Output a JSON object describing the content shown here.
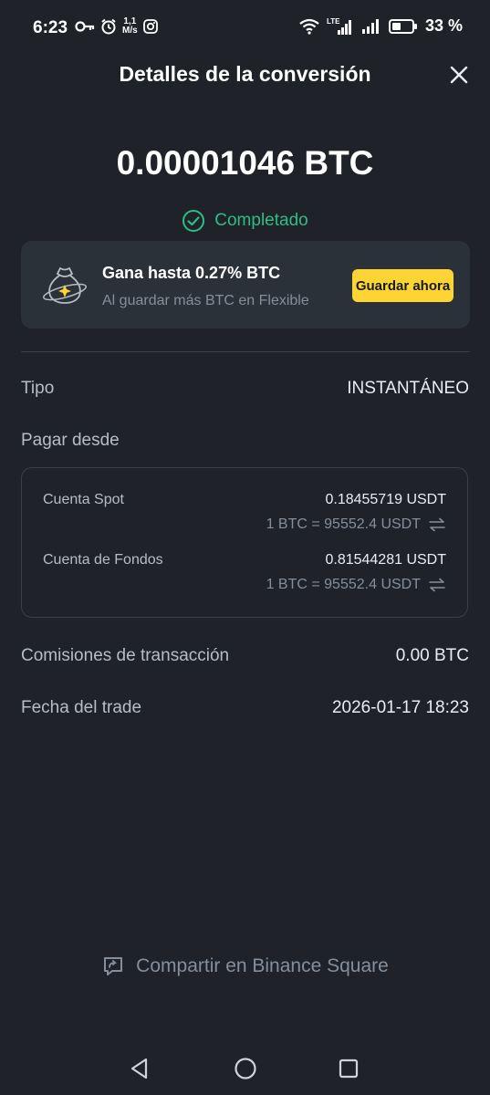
{
  "status_bar": {
    "time": "6:23",
    "net_speed_value": "1,1",
    "net_speed_unit": "M/s",
    "network_label": "LTE",
    "battery": "33 %"
  },
  "header": {
    "title": "Detalles de la conversión"
  },
  "summary": {
    "amount": "0.00001046 BTC",
    "status": "Completado",
    "status_color": "#2ebd85"
  },
  "promo": {
    "title": "Gana hasta 0.27% BTC",
    "subtitle": "Al guardar más BTC en Flexible",
    "button": "Guardar ahora",
    "button_color": "#fcd535"
  },
  "details": {
    "type_label": "Tipo",
    "type_value": "INSTANTÁNEO",
    "pay_from_label": "Pagar desde",
    "accounts": [
      {
        "name": "Cuenta Spot",
        "amount": "0.18455719 USDT",
        "rate": "1 BTC = 95552.4 USDT"
      },
      {
        "name": "Cuenta de Fondos",
        "amount": "0.81544281 USDT",
        "rate": "1 BTC = 95552.4 USDT"
      }
    ],
    "fee_label": "Comisiones de transacción",
    "fee_value": "0.00 BTC",
    "date_label": "Fecha del trade",
    "date_value": "2026-01-17 18:23"
  },
  "share": {
    "label": "Compartir en Binance Square"
  },
  "icons": {
    "close": "close-icon",
    "check": "check-circle-icon",
    "promo": "savings-bag-icon",
    "swap": "swap-arrows-icon",
    "share": "share-chat-icon",
    "nav_back": "back-triangle-icon",
    "nav_home": "home-circle-icon",
    "nav_recents": "recents-square-icon"
  }
}
